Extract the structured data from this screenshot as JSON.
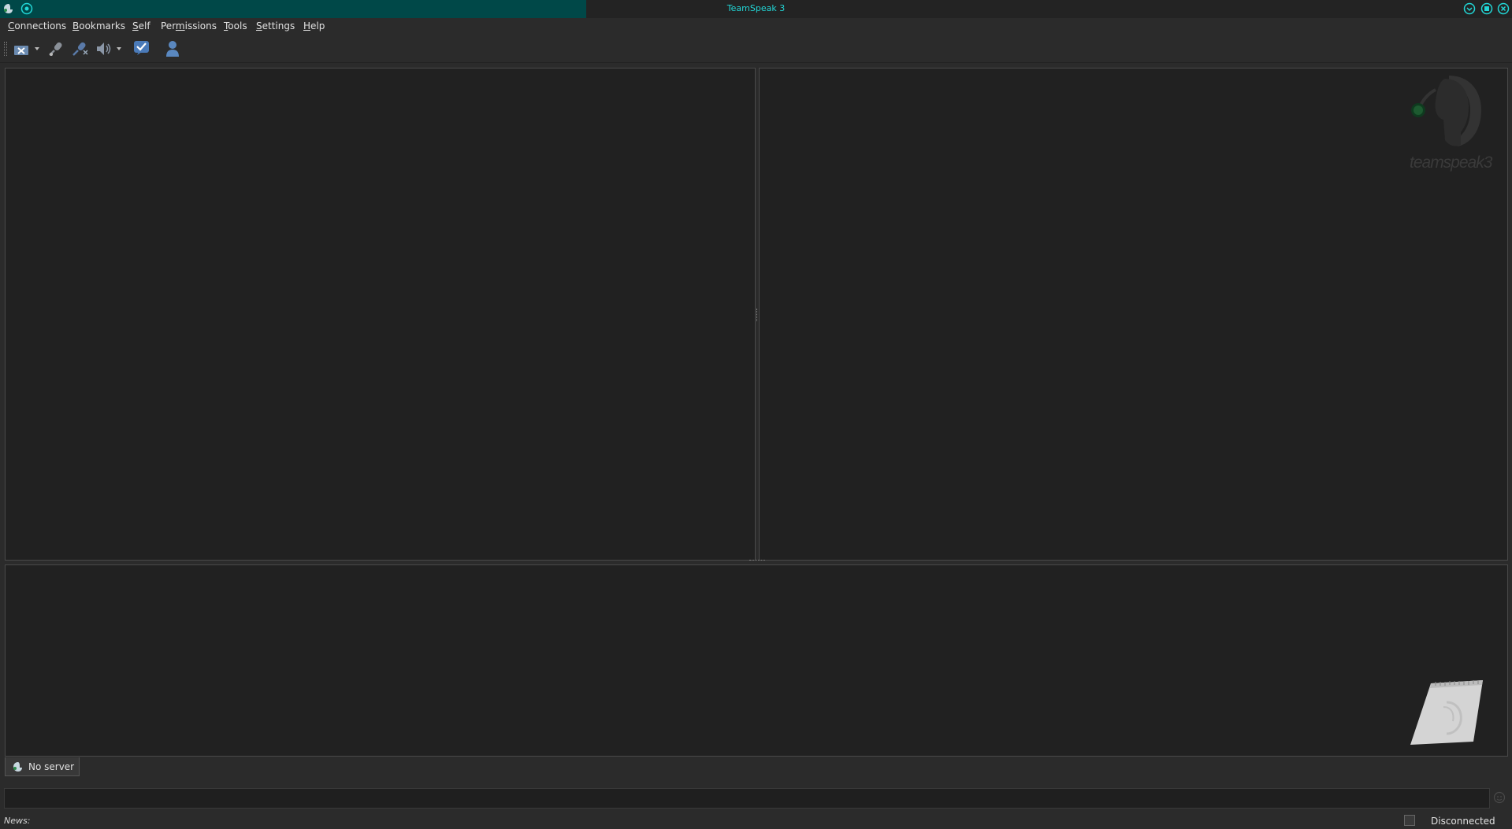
{
  "window": {
    "title": "TeamSpeak 3"
  },
  "menu": [
    {
      "label": "Connections",
      "key": "C",
      "rest": "onnections"
    },
    {
      "label": "Bookmarks",
      "key": "B",
      "rest": "ookmarks"
    },
    {
      "label": "Self",
      "key": "S",
      "rest": "elf"
    },
    {
      "label": "Permissions",
      "pre": "Per",
      "key": "m",
      "rest": "issions"
    },
    {
      "label": "Tools",
      "key": "T",
      "rest": "ools"
    },
    {
      "label": "Settings",
      "key": "S",
      "rest": "ettings"
    },
    {
      "label": "Help",
      "key": "H",
      "rest": "elp"
    }
  ],
  "toolbar": {
    "icons": [
      "disconnect-icon",
      "mute-microphone-icon",
      "mute-speakers-icon",
      "away-status-icon",
      "contacts-icon"
    ]
  },
  "logo": {
    "text": "teamspeak3"
  },
  "tabs": [
    {
      "label": "No server",
      "icon": "server-icon"
    }
  ],
  "status": {
    "news_label": "News:",
    "connection_status": "Disconnected"
  },
  "colors": {
    "accent": "#004848",
    "title_text": "#22d6d6",
    "pane_bg": "#212121",
    "window_bg": "#2b2b2b"
  }
}
